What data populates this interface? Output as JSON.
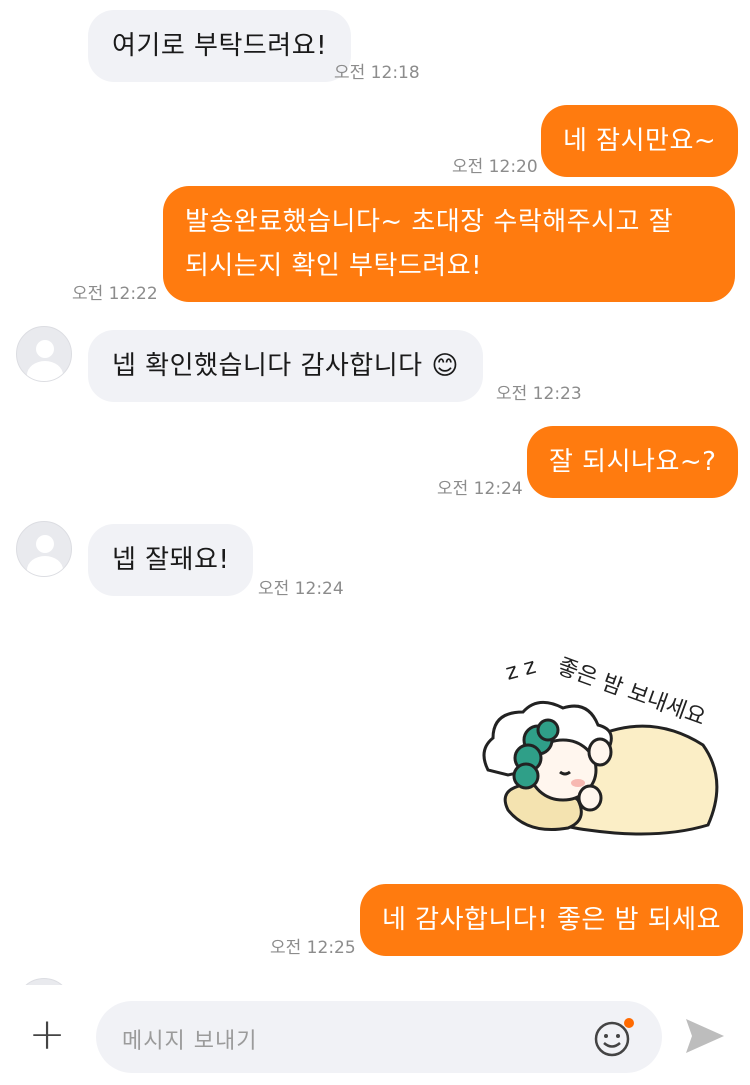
{
  "messages": [
    {
      "side": "in",
      "text": "여기로 부탁드려요!",
      "time": "오전 12:18"
    },
    {
      "side": "out",
      "text": "네 잠시만요~",
      "time": "오전 12:20"
    },
    {
      "side": "out",
      "lines": [
        "발송완료했습니다~ 초대장 수락해주시고 잘",
        "되시는지 확인 부탁드려요!"
      ],
      "time": "오전 12:22"
    },
    {
      "side": "in",
      "text": "넵 확인했습니다 감사합니다",
      "emoji": "😊",
      "time": "오전 12:23"
    },
    {
      "side": "out",
      "text": "잘 되시나요~?",
      "time": "오전 12:24"
    },
    {
      "side": "in",
      "text": "넵 잘돼요!",
      "time": "오전 12:24"
    },
    {
      "side": "in",
      "sticker": "sleeping-character-sticker",
      "sticker_text": "좋은 밤 보내세요",
      "sticker_zz": "z z"
    },
    {
      "side": "out",
      "text": "네 감사합니다! 좋은 밤 되세요",
      "time": "오전 12:25"
    }
  ],
  "composer": {
    "placeholder": "메시지 보내기",
    "plus_label": "+",
    "emoji_icon": "emoji-icon",
    "send_icon": "send-icon"
  },
  "colors": {
    "outgoing_bubble": "#ff7b0f",
    "incoming_bubble": "#f1f2f6",
    "notification_dot": "#ff6a00"
  }
}
